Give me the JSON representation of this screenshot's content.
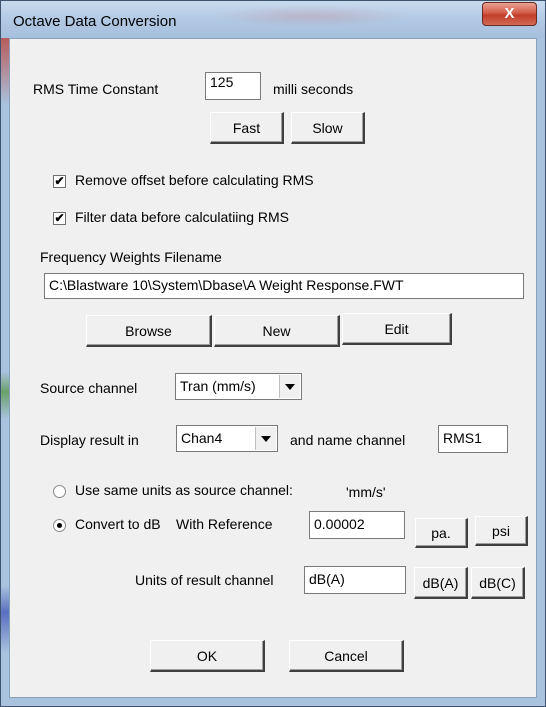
{
  "window": {
    "title": "Octave Data Conversion",
    "close_glyph": "X"
  },
  "rms": {
    "label": "RMS Time Constant",
    "value": "125",
    "unit": "milli seconds",
    "fast_label": "Fast",
    "slow_label": "Slow"
  },
  "options": {
    "remove_offset": {
      "label": "Remove offset before calculating RMS",
      "checked": true
    },
    "filter_data": {
      "label": "Filter data before calculatiing RMS",
      "checked": true
    }
  },
  "weights": {
    "label": "Frequency Weights Filename",
    "value": "C:\\Blastware 10\\System\\Dbase\\A Weight Response.FWT",
    "browse_label": "Browse",
    "new_label": "New",
    "edit_label": "Edit"
  },
  "source": {
    "label": "Source channel",
    "selected": "Tran (mm/s)"
  },
  "display": {
    "label": "Display result in",
    "selected": "Chan4",
    "name_label": "and name channel",
    "name_value": "RMS1"
  },
  "units": {
    "same_label": "Use same units as source channel:",
    "same_value": "'mm/s'",
    "same_selected": false,
    "db_label": "Convert to dB",
    "db_selected": true,
    "reference_label": "With Reference",
    "reference_value": "0.00002",
    "pa_label": "pa.",
    "psi_label": "psi",
    "result_label": "Units of result channel",
    "result_value": "dB(A)",
    "dba_label": "dB(A)",
    "dbc_label": "dB(C)"
  },
  "footer": {
    "ok_label": "OK",
    "cancel_label": "Cancel"
  },
  "icons": {
    "check": "✔",
    "close": "x-icon"
  }
}
